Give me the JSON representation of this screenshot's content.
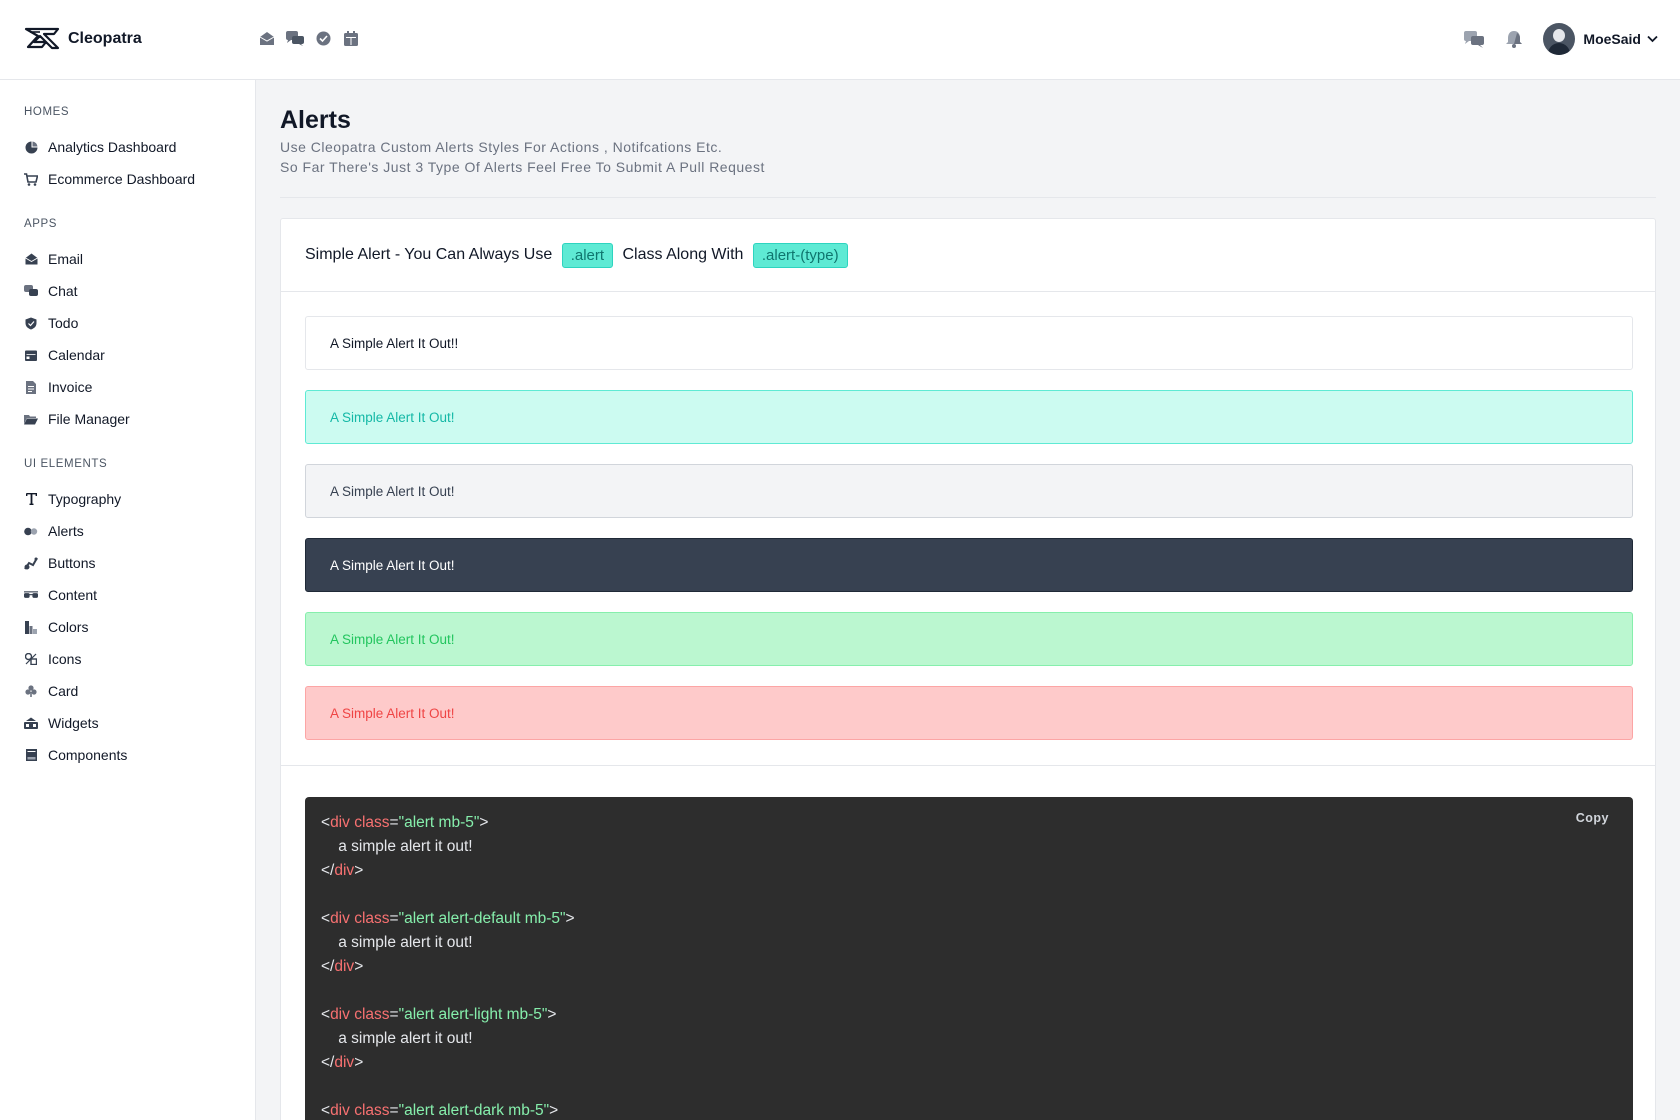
{
  "app": {
    "name": "Cleopatra"
  },
  "header": {
    "quick_icons": [
      "envelope-open-icon",
      "comments-icon",
      "check-circle-icon",
      "calendar-icon"
    ],
    "right_icons": [
      "comments-icon",
      "bell-icon"
    ],
    "user": {
      "name": "MoeSaid"
    }
  },
  "sidebar": {
    "sections": [
      {
        "title": "Homes",
        "items": [
          {
            "label": "Analytics Dashboard",
            "icon": "chart-pie-icon"
          },
          {
            "label": "Ecommerce Dashboard",
            "icon": "shopping-cart-icon"
          }
        ]
      },
      {
        "title": "Apps",
        "items": [
          {
            "label": "Email",
            "icon": "envelope-open-icon"
          },
          {
            "label": "Chat",
            "icon": "comments-icon"
          },
          {
            "label": "Todo",
            "icon": "shield-check-icon"
          },
          {
            "label": "Calendar",
            "icon": "calendar-icon"
          },
          {
            "label": "Invoice",
            "icon": "file-invoice-icon"
          },
          {
            "label": "File Manager",
            "icon": "folder-open-icon"
          }
        ]
      },
      {
        "title": "UI Elements",
        "items": [
          {
            "label": "Typography",
            "icon": "text-icon"
          },
          {
            "label": "Alerts",
            "icon": "alert-icon"
          },
          {
            "label": "Buttons",
            "icon": "hand-pointer-icon"
          },
          {
            "label": "Content",
            "icon": "glasses-icon"
          },
          {
            "label": "Colors",
            "icon": "palette-icon"
          },
          {
            "label": "Icons",
            "icon": "icons-icon"
          },
          {
            "label": "Card",
            "icon": "club-icon"
          },
          {
            "label": "Widgets",
            "icon": "widgets-icon"
          },
          {
            "label": "Components",
            "icon": "components-icon"
          }
        ]
      }
    ]
  },
  "page": {
    "title": "Alerts",
    "subtitle_1": "Use Cleopatra Custom Alerts Styles For Actions , Notifcations Etc.",
    "subtitle_2": "So Far There's Just 3 Type Of Alerts Feel Free To Submit A Pull Request"
  },
  "card": {
    "heading_pre": "Simple Alert - You Can Always Use ",
    "chip_1": ".alert",
    "heading_mid": " Class Along With ",
    "chip_2": ".alert-(type)",
    "alerts": [
      {
        "text": "A Simple Alert It Out!!",
        "variant": "plain"
      },
      {
        "text": "A Simple Alert It Out!",
        "variant": "default"
      },
      {
        "text": "A Simple Alert It Out!",
        "variant": "light"
      },
      {
        "text": "A Simple Alert It Out!",
        "variant": "dark"
      },
      {
        "text": "A Simple Alert It Out!",
        "variant": "success"
      },
      {
        "text": "A Simple Alert It Out!",
        "variant": "error"
      }
    ],
    "copy_label": "Copy",
    "code_lines": [
      [
        [
          "p",
          "<"
        ],
        [
          "t",
          "div"
        ],
        [
          "a",
          " class"
        ],
        [
          "p",
          "="
        ],
        [
          "s",
          "\"alert mb-5\""
        ],
        [
          "p",
          ">"
        ]
      ],
      [
        [
          "x",
          "    a simple alert it out!"
        ]
      ],
      [
        [
          "p",
          "</"
        ],
        [
          "t",
          "div"
        ],
        [
          "p",
          ">"
        ]
      ],
      [],
      [
        [
          "p",
          "<"
        ],
        [
          "t",
          "div"
        ],
        [
          "a",
          " class"
        ],
        [
          "p",
          "="
        ],
        [
          "s",
          "\"alert alert-default mb-5\""
        ],
        [
          "p",
          ">"
        ]
      ],
      [
        [
          "x",
          "    a simple alert it out!"
        ]
      ],
      [
        [
          "p",
          "</"
        ],
        [
          "t",
          "div"
        ],
        [
          "p",
          ">"
        ]
      ],
      [],
      [
        [
          "p",
          "<"
        ],
        [
          "t",
          "div"
        ],
        [
          "a",
          " class"
        ],
        [
          "p",
          "="
        ],
        [
          "s",
          "\"alert alert-light mb-5\""
        ],
        [
          "p",
          ">"
        ]
      ],
      [
        [
          "x",
          "    a simple alert it out!"
        ]
      ],
      [
        [
          "p",
          "</"
        ],
        [
          "t",
          "div"
        ],
        [
          "p",
          ">"
        ]
      ],
      [],
      [
        [
          "p",
          "<"
        ],
        [
          "t",
          "div"
        ],
        [
          "a",
          " class"
        ],
        [
          "p",
          "="
        ],
        [
          "s",
          "\"alert alert-dark mb-5\""
        ],
        [
          "p",
          ">"
        ]
      ]
    ]
  },
  "colors": {
    "accent": "#2dd4bf",
    "dark": "#374151",
    "success": "#22c55e",
    "error": "#ef4444"
  }
}
